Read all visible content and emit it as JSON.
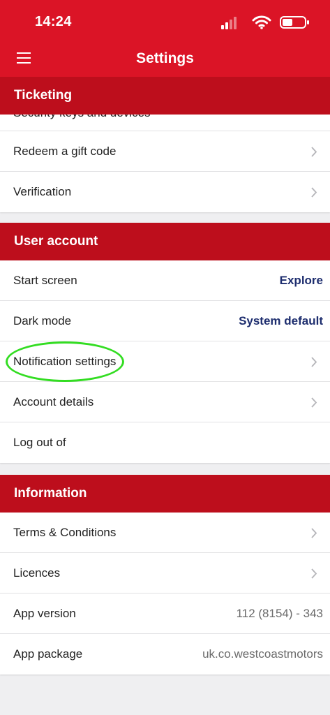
{
  "status_bar": {
    "time": "14:24"
  },
  "nav": {
    "title": "Settings",
    "menu_icon": "hamburger-icon"
  },
  "sections": {
    "ticketing": {
      "header": "Ticketing",
      "partial_item": "Security keys and devices",
      "items": [
        {
          "label": "Redeem a gift code"
        },
        {
          "label": "Verification"
        }
      ]
    },
    "user_account": {
      "header": "User account",
      "items": [
        {
          "label": "Start screen",
          "value": "Explore"
        },
        {
          "label": "Dark mode",
          "value": "System default"
        },
        {
          "label": "Notification settings"
        },
        {
          "label": "Account details"
        },
        {
          "label": "Log out of"
        }
      ]
    },
    "information": {
      "header": "Information",
      "items": [
        {
          "label": "Terms & Conditions"
        },
        {
          "label": "Licences"
        },
        {
          "label": "App version",
          "value": "112 (8154) - 343"
        },
        {
          "label": "App package",
          "value": "uk.co.westcoastmotors"
        }
      ]
    }
  },
  "colors": {
    "brand_red": "#db1426",
    "section_red": "#bd0e1c",
    "value_blue": "#1d2d6e",
    "highlight": "#33dd22"
  }
}
